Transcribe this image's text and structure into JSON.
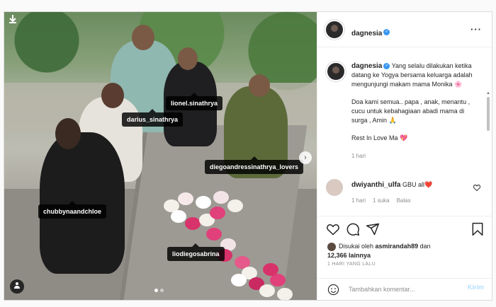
{
  "post": {
    "username": "dagnesia",
    "caption_lines": [
      "Yang selalu dilakukan ketika datang ke Yogya bersama keluarga adalah mengunjungi makam mama Monika 🌸",
      "Doa kami semua.. papa , anak, menantu , cucu untuk kebahagiaan abadi mama di surga , Amin 🙏",
      "Rest In Love Ma 💖"
    ],
    "caption_time": "1 hari",
    "tags": [
      {
        "label": "lionel.sinathrya"
      },
      {
        "label": "darius_sinathrya"
      },
      {
        "label": "diegoandressinathrya_lovers"
      },
      {
        "label": "chubbynaandchloe"
      },
      {
        "label": "liodiegosabrina"
      }
    ],
    "comment": {
      "username": "dwiyanthi_ulfa",
      "text": "GBU all❤️",
      "time": "1 hari",
      "likes": "1 suka",
      "reply": "Balas"
    },
    "likes_prefix": "Disukai oleh",
    "likes_user": "asmirandah89",
    "likes_and": "dan",
    "likes_count": "12,366 lainnya",
    "date": "1 HARI YANG LALU",
    "composer_placeholder": "Tambahkan komentar...",
    "post_label": "Kirim"
  },
  "icons": {
    "download": "download-icon",
    "more": "more-options-icon",
    "verified": "verified-badge-icon",
    "heart": "heart-icon",
    "comment": "comment-icon",
    "share": "share-icon",
    "save": "bookmark-icon",
    "emoji": "emoji-icon",
    "user_tag": "user-tag-icon"
  },
  "colors": {
    "verified": "#3897f0",
    "post_btn_disabled": "#b2dffc",
    "text": "#262626",
    "muted": "#8e8e8e"
  },
  "carousel": {
    "count": 2,
    "active": 1
  }
}
